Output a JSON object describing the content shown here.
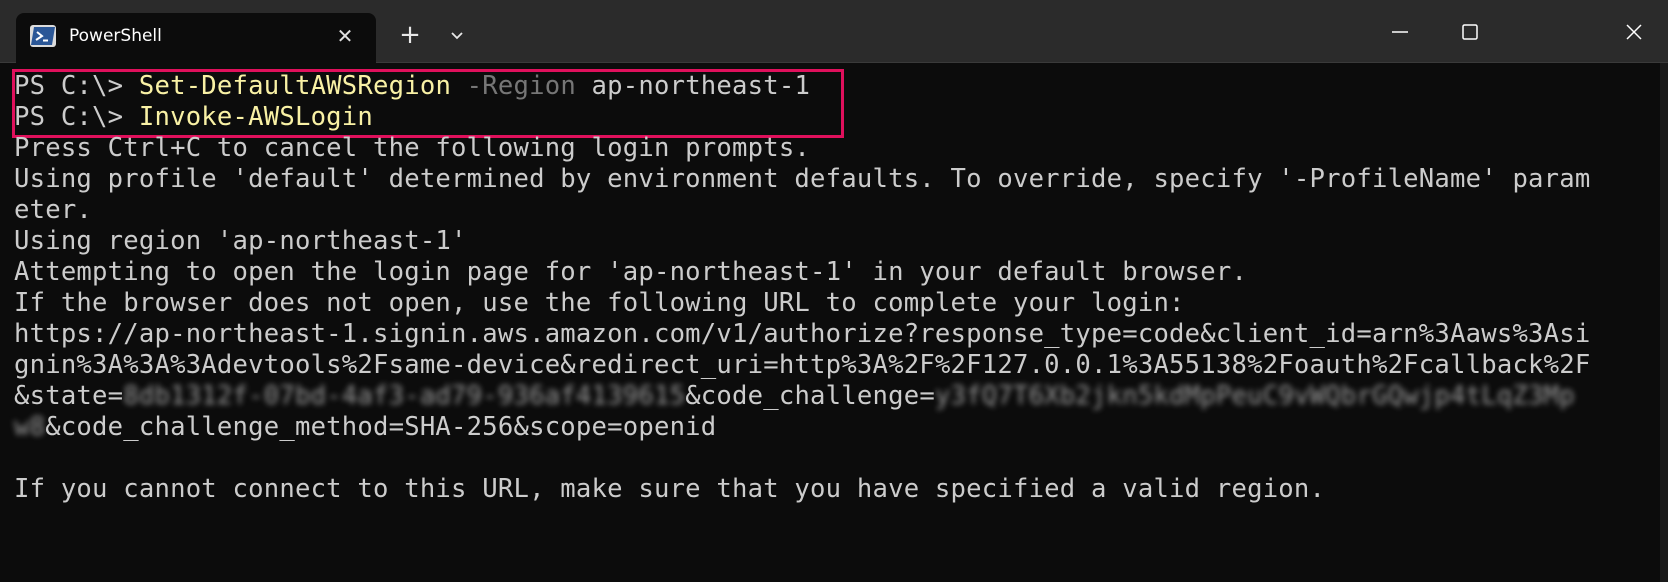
{
  "window": {
    "tab_title": "PowerShell",
    "tab_close_glyph": "✕",
    "new_tab_glyph": "+",
    "icons": [
      "powershell-icon",
      "close-icon",
      "plus-icon",
      "chevron-down-icon",
      "minimize-icon",
      "maximize-icon",
      "window-close-icon"
    ]
  },
  "terminal": {
    "line1": {
      "prompt": "PS C:\\> ",
      "cmd": "Set-DefaultAWSRegion",
      "space1": " ",
      "param": "-Region",
      "arg": " ap-northeast-1"
    },
    "line2": {
      "prompt": "PS C:\\> ",
      "cmd": "Invoke-AWSLogin"
    },
    "line3": "Press Ctrl+C to cancel the following login prompts.",
    "line4": "Using profile 'default' determined by environment defaults. To override, specify '-ProfileName' param",
    "line5": "eter.",
    "line6": "Using region 'ap-northeast-1'",
    "line7": "Attempting to open the login page for 'ap-northeast-1' in your default browser.",
    "line8": "If the browser does not open, use the following URL to complete your login:",
    "line9": "https://ap-northeast-1.signin.aws.amazon.com/v1/authorize?response_type=code&client_id=arn%3Aaws%3Asi",
    "line10": "gnin%3A%3A%3Adevtools%2Fsame-device&redirect_uri=http%3A%2F%2F127.0.0.1%3A55138%2Foauth%2Fcallback%2F",
    "line11": {
      "prefix": "&state=",
      "blurred_state": "8db1312f-07bd-4af3-ad79-936af4139615",
      "middle": "&code_challenge=",
      "blurred_challenge": "y3fQ7T6Xb2jkn5kdMpPeuC9vWQbrGQwjp4tLqZ3Mp"
    },
    "line12": {
      "blurred": "w8",
      "rest": "&code_challenge_method=SHA-256&scope=openid"
    },
    "line13": "",
    "line14": "If you cannot connect to this URL, make sure that you have specified a valid region."
  },
  "colors": {
    "background": "#0c0c0c",
    "text": "#cccccc",
    "command": "#f9f1a5",
    "parameter": "#767676",
    "highlight_box": "#e0105c"
  }
}
